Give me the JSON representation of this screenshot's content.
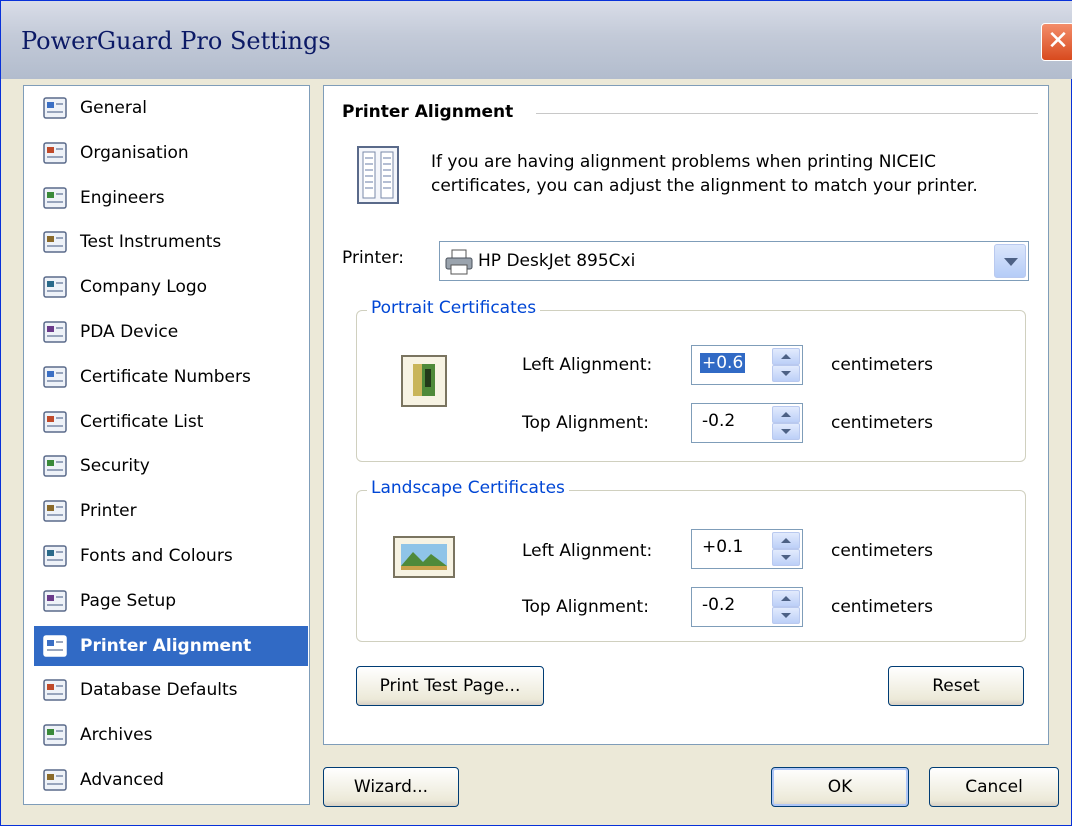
{
  "window": {
    "title": "PowerGuard Pro Settings",
    "close_glyph": "✕"
  },
  "sidebar": {
    "items": [
      {
        "label": "General",
        "icon": "general-icon"
      },
      {
        "label": "Organisation",
        "icon": "organisation-icon"
      },
      {
        "label": "Engineers",
        "icon": "engineers-icon"
      },
      {
        "label": "Test Instruments",
        "icon": "tools-icon"
      },
      {
        "label": "Company Logo",
        "icon": "logo-icon"
      },
      {
        "label": "PDA Device",
        "icon": "pda-icon"
      },
      {
        "label": "Certificate Numbers",
        "icon": "abc-123-icon"
      },
      {
        "label": "Certificate List",
        "icon": "list-icon"
      },
      {
        "label": "Security",
        "icon": "padlock-icon"
      },
      {
        "label": "Printer",
        "icon": "printer-icon"
      },
      {
        "label": "Fonts and Colours",
        "icon": "font-icon"
      },
      {
        "label": "Page Setup",
        "icon": "page-setup-icon"
      },
      {
        "label": "Printer Alignment",
        "icon": "alignment-icon",
        "selected": true
      },
      {
        "label": "Database Defaults",
        "icon": "database-icon"
      },
      {
        "label": "Archives",
        "icon": "archives-icon"
      },
      {
        "label": "Advanced",
        "icon": "advanced-icon"
      }
    ]
  },
  "panel": {
    "heading": "Printer Alignment",
    "intro": "If you are having alignment problems when printing NICEIC certificates, you can adjust the alignment to match your printer.",
    "printer_label": "Printer:",
    "printer_value": "HP DeskJet 895Cxi",
    "portrait": {
      "title": "Portrait Certificates",
      "left_label": "Left Alignment:",
      "left_value": "+0.6",
      "top_label": "Top Alignment:",
      "top_value": "-0.2",
      "unit": "centimeters"
    },
    "landscape": {
      "title": "Landscape Certificates",
      "left_label": "Left Alignment:",
      "left_value": "+0.1",
      "top_label": "Top Alignment:",
      "top_value": "-0.2",
      "unit": "centimeters"
    },
    "print_test_label": "Print Test Page...",
    "reset_label": "Reset"
  },
  "footer": {
    "wizard_label": "Wizard...",
    "ok_label": "OK",
    "cancel_label": "Cancel"
  },
  "colors": {
    "selection": "#316ac5",
    "group_title": "#0046d5",
    "dialog_bg": "#ece9d8"
  }
}
